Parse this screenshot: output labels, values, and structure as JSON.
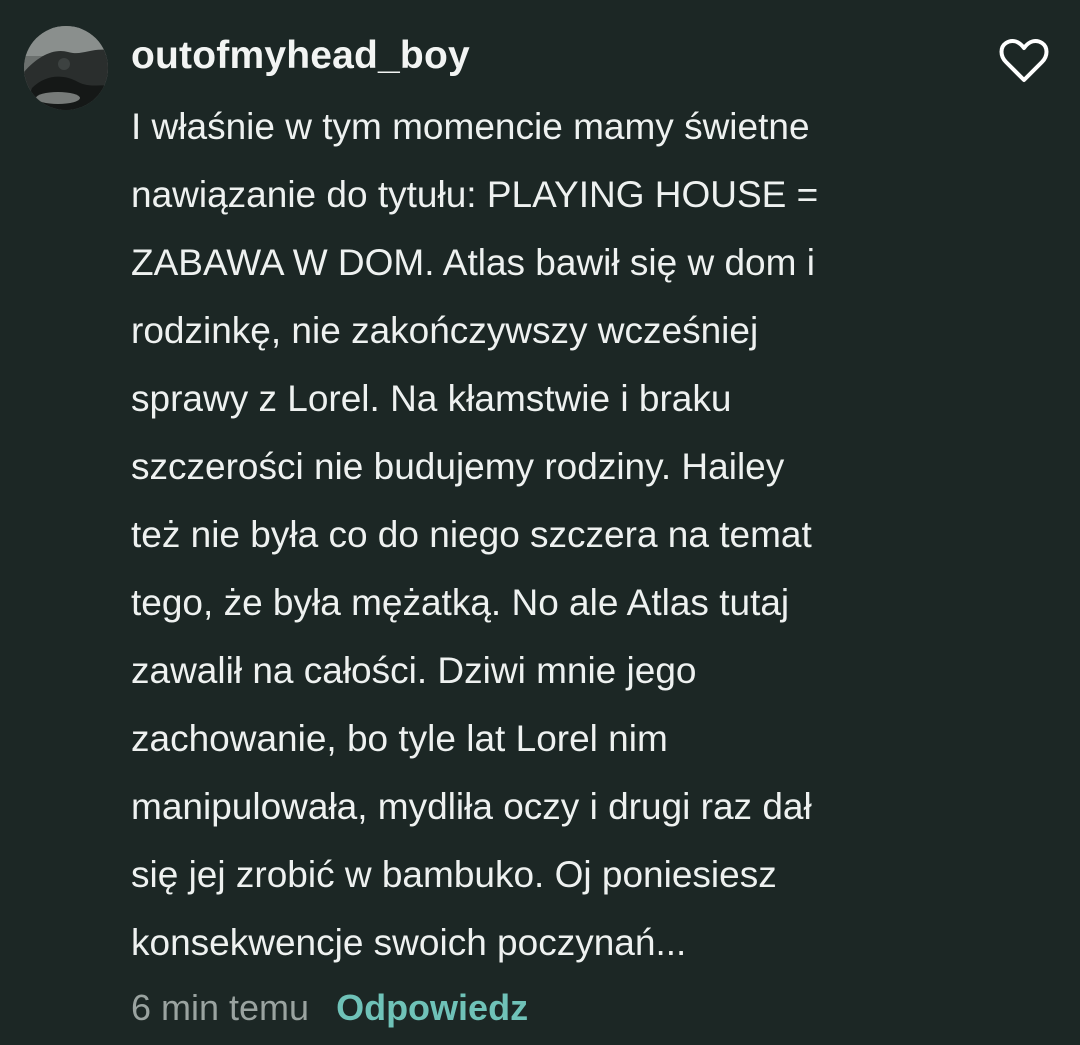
{
  "comment": {
    "username": "outofmyhead_boy",
    "avatar": "avatar-image",
    "like_icon": "heart-outline-icon",
    "lines": [
      "I właśnie w tym momencie mamy świetne",
      "nawiązanie do tytułu: PLAYING HOUSE =",
      "ZABAWA W DOM. Atlas bawił się w dom i",
      "rodzinkę, nie zakończywszy wcześniej",
      "sprawy z Lorel. Na kłamstwie i braku",
      "szczerości nie budujemy rodziny. Hailey",
      "też nie była co do niego szczera na temat",
      "tego, że była mężatką. No ale Atlas tutaj",
      "zawalił na całości. Dziwi mnie jego",
      "zachowanie, bo tyle lat Lorel nim",
      "manipulowała, mydliła oczy i drugi raz dał",
      "się jej zrobić w bambuko. Oj poniesiesz",
      "konsekwencje swoich poczynań..."
    ],
    "timestamp": "6 min temu",
    "reply_label": "Odpowiedz"
  },
  "colors": {
    "background": "#1c2725",
    "text": "#eef1f0",
    "muted": "#9aa3a0",
    "accent": "#6fc2b8"
  }
}
